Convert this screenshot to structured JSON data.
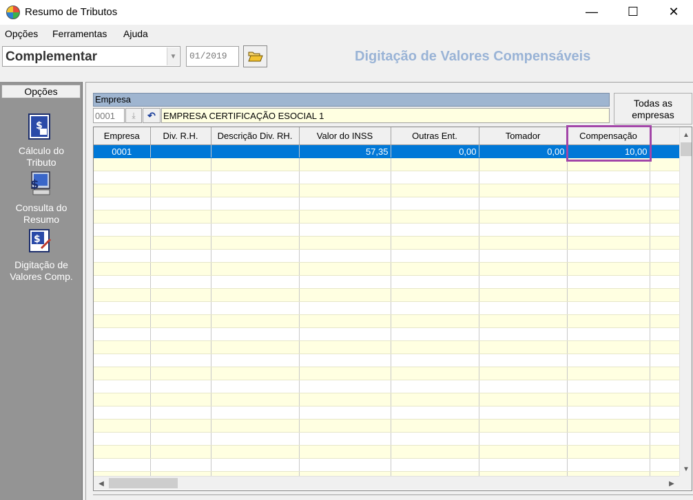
{
  "window": {
    "title": "Resumo de Tributos",
    "controls": {
      "minimize": "—",
      "maximize": "☐",
      "close": "✕"
    }
  },
  "menu": [
    "Opções",
    "Ferramentas",
    "Ajuda"
  ],
  "toolbar": {
    "mode_value": "Complementar",
    "period_value": "01/2019",
    "screen_title": "Digitação de Valores Compensáveis"
  },
  "sidebar": {
    "tab_label": "Opções",
    "items": [
      {
        "label_line1": "Cálculo do",
        "label_line2": "Tributo",
        "icon": "calculator-doc-icon"
      },
      {
        "label_line1": "Consulta do",
        "label_line2": "Resumo",
        "icon": "computer-money-icon"
      },
      {
        "label_line1": "Digitação de",
        "label_line2": "Valores Comp.",
        "icon": "money-edit-icon"
      }
    ]
  },
  "empresa": {
    "header": "Empresa",
    "code": "0001",
    "name": "EMPRESA CERTIFICAÇÃO ESOCIAL 1",
    "all_button_line1": "Todas as",
    "all_button_line2": "empresas"
  },
  "grid": {
    "columns": [
      "Empresa",
      "Div. R.H.",
      "Descrição Div. RH.",
      "Valor do INSS",
      "Outras Ent.",
      "Tomador",
      "Compensação",
      ""
    ],
    "rows": [
      [
        "0001",
        "",
        "",
        "57,35",
        "0,00",
        "0,00",
        "10,00",
        ""
      ]
    ]
  },
  "colors": {
    "selection": "#0078d7",
    "highlight": "#a245a8",
    "title_accent": "#99b3d6",
    "row_alt": "#ffffe1"
  }
}
